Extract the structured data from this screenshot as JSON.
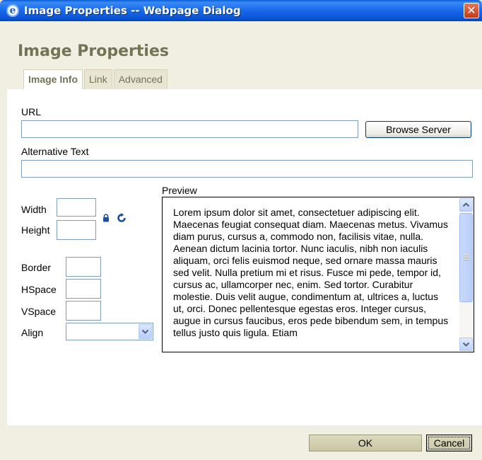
{
  "window": {
    "title": "Image Properties -- Webpage Dialog",
    "close_glyph": "✕",
    "app_icon_glyph": "e"
  },
  "dialog": {
    "heading": "Image Properties",
    "tabs": [
      {
        "label": "Image Info",
        "active": true
      },
      {
        "label": "Link",
        "active": false
      },
      {
        "label": "Advanced",
        "active": false
      }
    ]
  },
  "form": {
    "url_label": "URL",
    "url_value": "",
    "browse_label": "Browse Server",
    "alt_label": "Alternative Text",
    "alt_value": "",
    "width_label": "Width",
    "width_value": "",
    "height_label": "Height",
    "height_value": "",
    "border_label": "Border",
    "border_value": "",
    "hspace_label": "HSpace",
    "hspace_value": "",
    "vspace_label": "VSpace",
    "vspace_value": "",
    "align_label": "Align",
    "align_value": ""
  },
  "preview": {
    "label": "Preview",
    "text": "Lorem ipsum dolor sit amet, consectetuer adipiscing elit. Maecenas feugiat consequat diam. Maecenas metus. Vivamus diam purus, cursus a, commodo non, facilisis vitae, nulla. Aenean dictum lacinia tortor. Nunc iaculis, nibh non iaculis aliquam, orci felis euismod neque, sed ornare massa mauris sed velit. Nulla pretium mi et risus. Fusce mi pede, tempor id, cursus ac, ullamcorper nec, enim. Sed tortor. Curabitur molestie. Duis velit augue, condimentum at, ultrices a, luctus ut, orci. Donec pellentesque egestas eros. Integer cursus, augue in cursus faucibus, eros pede bibendum sem, in tempus tellus justo quis ligula. Etiam"
  },
  "footer": {
    "ok_label": "OK",
    "cancel_label": "Cancel"
  },
  "colors": {
    "titlebar": "#0a55d6",
    "dialog_bg": "#f1efe2",
    "heading": "#737357",
    "icon_blue": "#1c4fa0"
  },
  "icons": {
    "lock": "lock-icon",
    "reset": "reset-size-icon",
    "dropdown": "chevron-down-icon",
    "scroll_up": "chevron-up-icon",
    "scroll_down": "chevron-down-icon"
  }
}
